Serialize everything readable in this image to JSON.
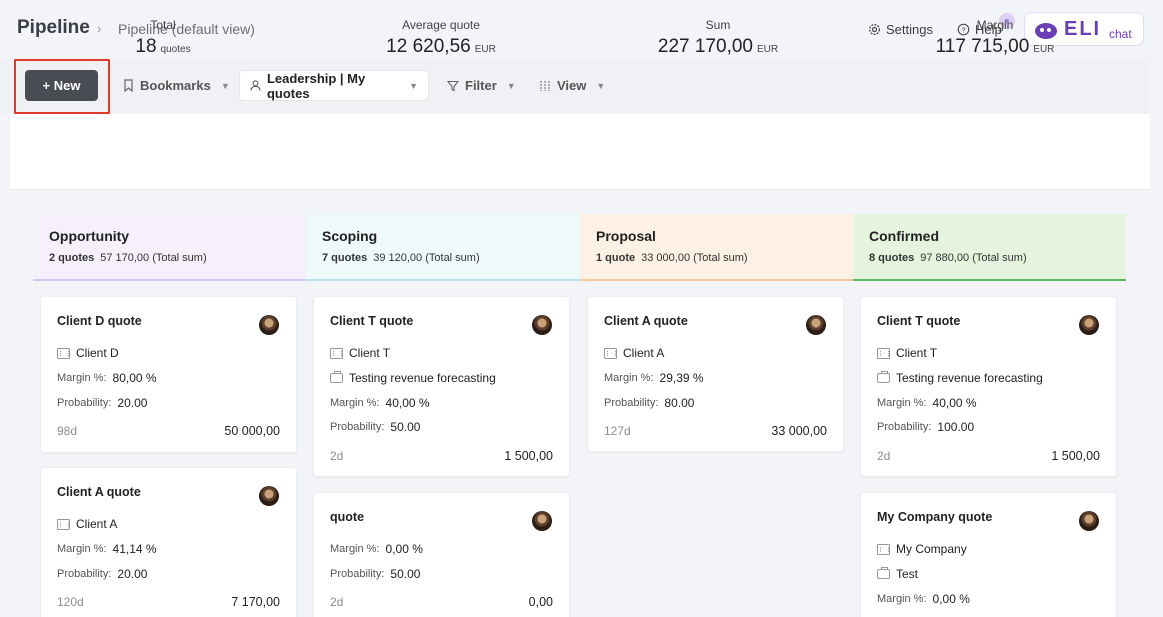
{
  "header": {
    "title": "Pipeline",
    "breadcrumb_sep": "›",
    "view": "Pipeline (default view)",
    "settings": "Settings",
    "help": "Help",
    "eli_brand": "ELI",
    "eli_suffix": "chat"
  },
  "toolbar": {
    "new": "+ New",
    "bookmarks": "Bookmarks",
    "quotes_view": "Leadership | My quotes",
    "filter": "Filter",
    "view": "View"
  },
  "stats": [
    {
      "label": "Total",
      "value": "18",
      "unit": "quotes"
    },
    {
      "label": "Average quote",
      "value": "12 620,56",
      "unit": "EUR"
    },
    {
      "label": "Sum",
      "value": "227 170,00",
      "unit": "EUR"
    },
    {
      "label": "Margin",
      "value": "117 715,00",
      "unit": "EUR"
    }
  ],
  "columns": [
    {
      "title": "Opportunity",
      "count": "2 quotes",
      "sum": "57 170,00 (Total sum)",
      "bg": "#f5f0fb",
      "line": "#d6c5ef",
      "cards": [
        {
          "title": "Client D quote",
          "client": "Client D",
          "project": "",
          "margin": "80,00 %",
          "probability": "20.00",
          "age": "98d",
          "amount": "50 000,00"
        },
        {
          "title": "Client A quote",
          "client": "Client A",
          "project": "",
          "margin": "41,14 %",
          "probability": "20.00",
          "age": "120d",
          "amount": "7 170,00"
        }
      ]
    },
    {
      "title": "Scoping",
      "count": "7 quotes",
      "sum": "39 120,00 (Total sum)",
      "bg": "#eef9fa",
      "line": "#b9e3e8",
      "cards": [
        {
          "title": "Client T quote",
          "client": "Client T",
          "project": "Testing revenue forecasting",
          "margin": "40,00 %",
          "probability": "50.00",
          "age": "2d",
          "amount": "1 500,00"
        },
        {
          "title": "quote",
          "client": "",
          "project": "",
          "margin": "0,00 %",
          "probability": "50.00",
          "age": "2d",
          "amount": "0,00"
        }
      ]
    },
    {
      "title": "Proposal",
      "count": "1 quote",
      "sum": "33 000,00 (Total sum)",
      "bg": "#fdf1e6",
      "line": "#f4c9a0",
      "cards": [
        {
          "title": "Client A quote",
          "client": "Client A",
          "project": "",
          "margin": "29,39 %",
          "probability": "80.00",
          "age": "127d",
          "amount": "33 000,00"
        }
      ]
    },
    {
      "title": "Confirmed",
      "count": "8 quotes",
      "sum": "97 880,00 (Total sum)",
      "bg": "#e4f4df",
      "line": "#5cb85c",
      "cards": [
        {
          "title": "Client T quote",
          "client": "Client T",
          "project": "Testing revenue forecasting",
          "margin": "40,00 %",
          "probability": "100.00",
          "age": "2d",
          "amount": "1 500,00"
        },
        {
          "title": "My Company quote",
          "client": "My Company",
          "project": "Test",
          "margin": "0,00 %",
          "probability": "",
          "age": "",
          "amount": ""
        }
      ]
    }
  ],
  "labels": {
    "margin": "Margin %:",
    "probability": "Probability:"
  }
}
